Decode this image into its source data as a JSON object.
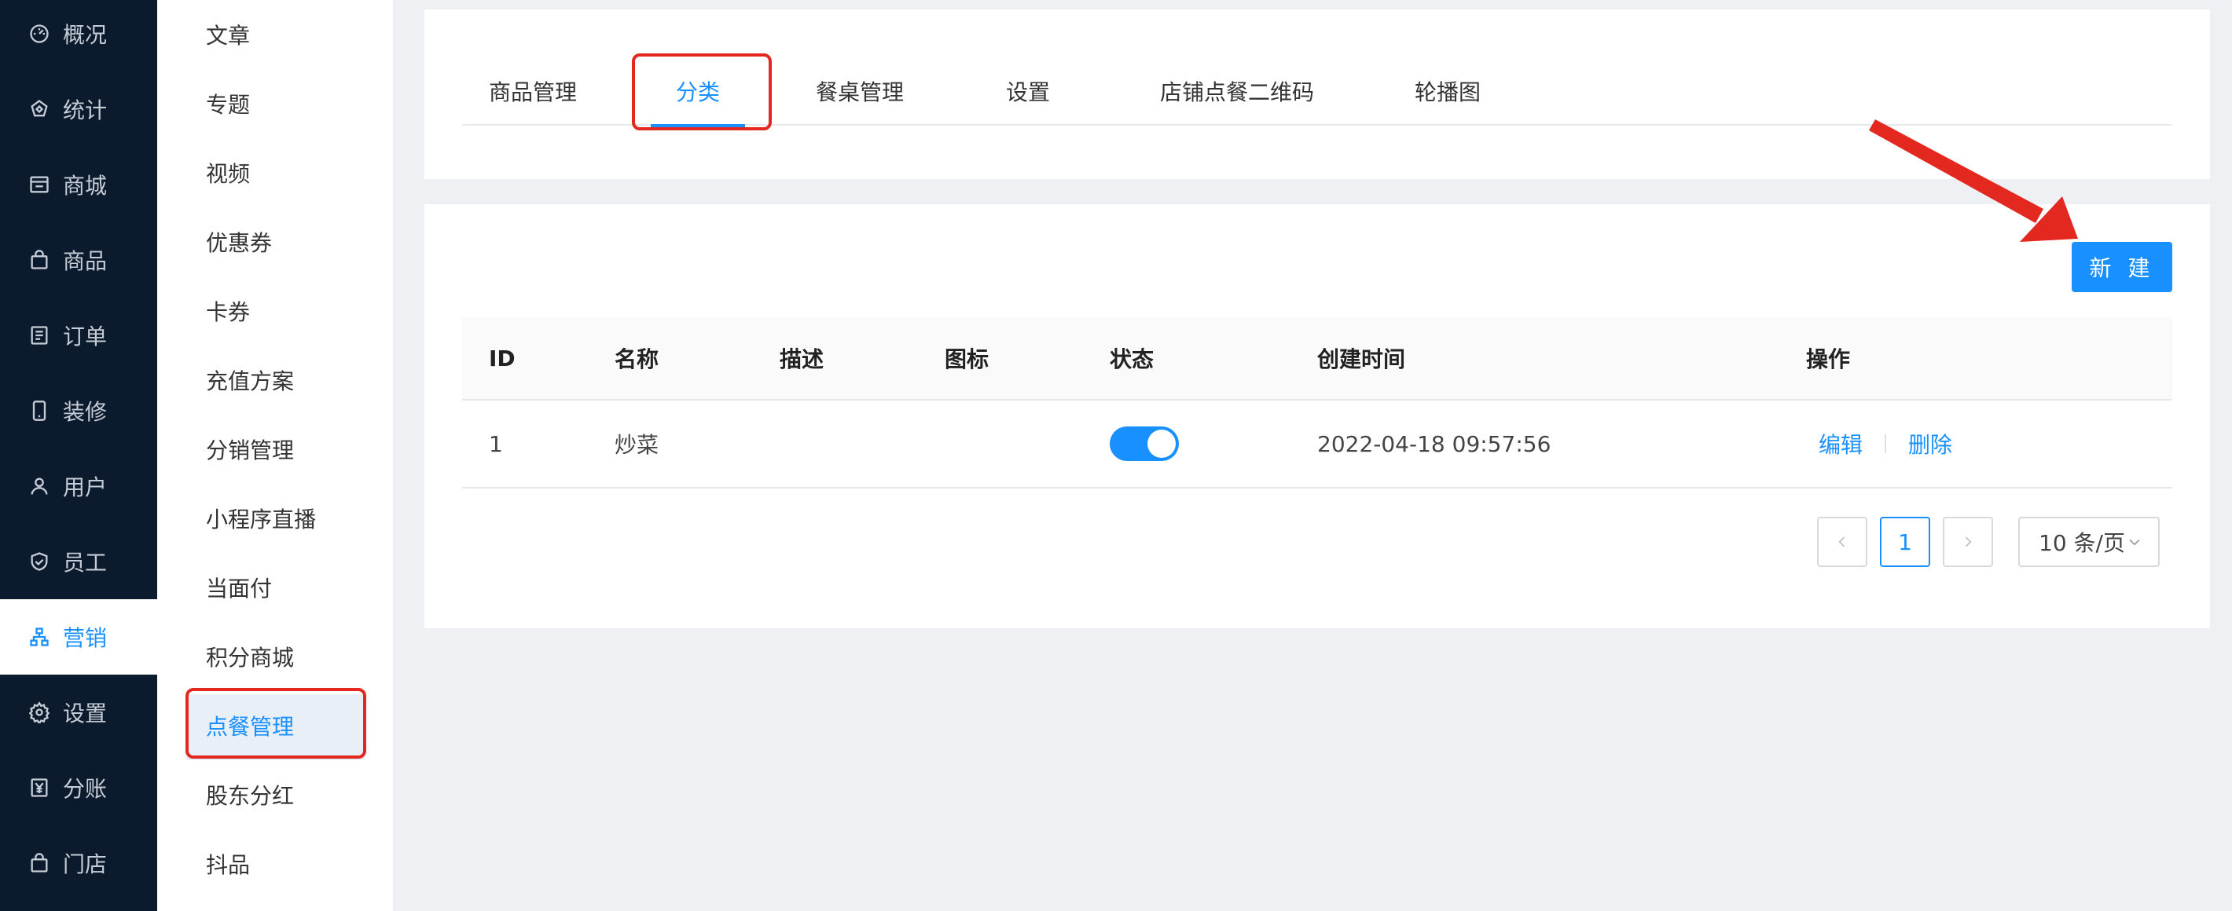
{
  "primary_nav": [
    {
      "label": "概况",
      "icon": "dashboard-icon",
      "active": false
    },
    {
      "label": "统计",
      "icon": "chart-icon",
      "active": false
    },
    {
      "label": "商城",
      "icon": "store-icon",
      "active": false
    },
    {
      "label": "商品",
      "icon": "bag-icon",
      "active": false
    },
    {
      "label": "订单",
      "icon": "order-icon",
      "active": false
    },
    {
      "label": "装修",
      "icon": "phone-icon",
      "active": false
    },
    {
      "label": "用户",
      "icon": "user-icon",
      "active": false
    },
    {
      "label": "员工",
      "icon": "shield-icon",
      "active": false
    },
    {
      "label": "营销",
      "icon": "network-icon",
      "active": true
    },
    {
      "label": "设置",
      "icon": "gear-icon",
      "active": false
    },
    {
      "label": "分账",
      "icon": "yen-icon",
      "active": false
    },
    {
      "label": "门店",
      "icon": "shop-icon",
      "active": false
    }
  ],
  "secondary_nav": [
    {
      "label": "文章",
      "active": false
    },
    {
      "label": "专题",
      "active": false
    },
    {
      "label": "视频",
      "active": false
    },
    {
      "label": "优惠券",
      "active": false
    },
    {
      "label": "卡券",
      "active": false
    },
    {
      "label": "充值方案",
      "active": false
    },
    {
      "label": "分销管理",
      "active": false
    },
    {
      "label": "小程序直播",
      "active": false
    },
    {
      "label": "当面付",
      "active": false
    },
    {
      "label": "积分商城",
      "active": false
    },
    {
      "label": "点餐管理",
      "active": true
    },
    {
      "label": "股东分红",
      "active": false
    },
    {
      "label": "抖品",
      "active": false
    }
  ],
  "tabs": [
    {
      "label": "商品管理",
      "active": false
    },
    {
      "label": "分类",
      "active": true
    },
    {
      "label": "餐桌管理",
      "active": false
    },
    {
      "label": "设置",
      "active": false
    },
    {
      "label": "店铺点餐二维码",
      "active": false
    },
    {
      "label": "轮播图",
      "active": false
    }
  ],
  "toolbar": {
    "new_label": "新 建"
  },
  "table": {
    "headers": [
      "ID",
      "名称",
      "描述",
      "图标",
      "状态",
      "创建时间",
      "操作"
    ],
    "rows": [
      {
        "id": "1",
        "name": "炒菜",
        "description": "",
        "icon": "",
        "status_on": true,
        "created": "2022-04-18 09:57:56",
        "edit_label": "编辑",
        "delete_label": "删除"
      }
    ]
  },
  "pagination": {
    "current_page": "1",
    "page_size_label": "10 条/页"
  },
  "colors": {
    "accent": "#1890ff",
    "sidebar_bg": "#0b1a2d",
    "annotation_red": "#e3281f"
  }
}
